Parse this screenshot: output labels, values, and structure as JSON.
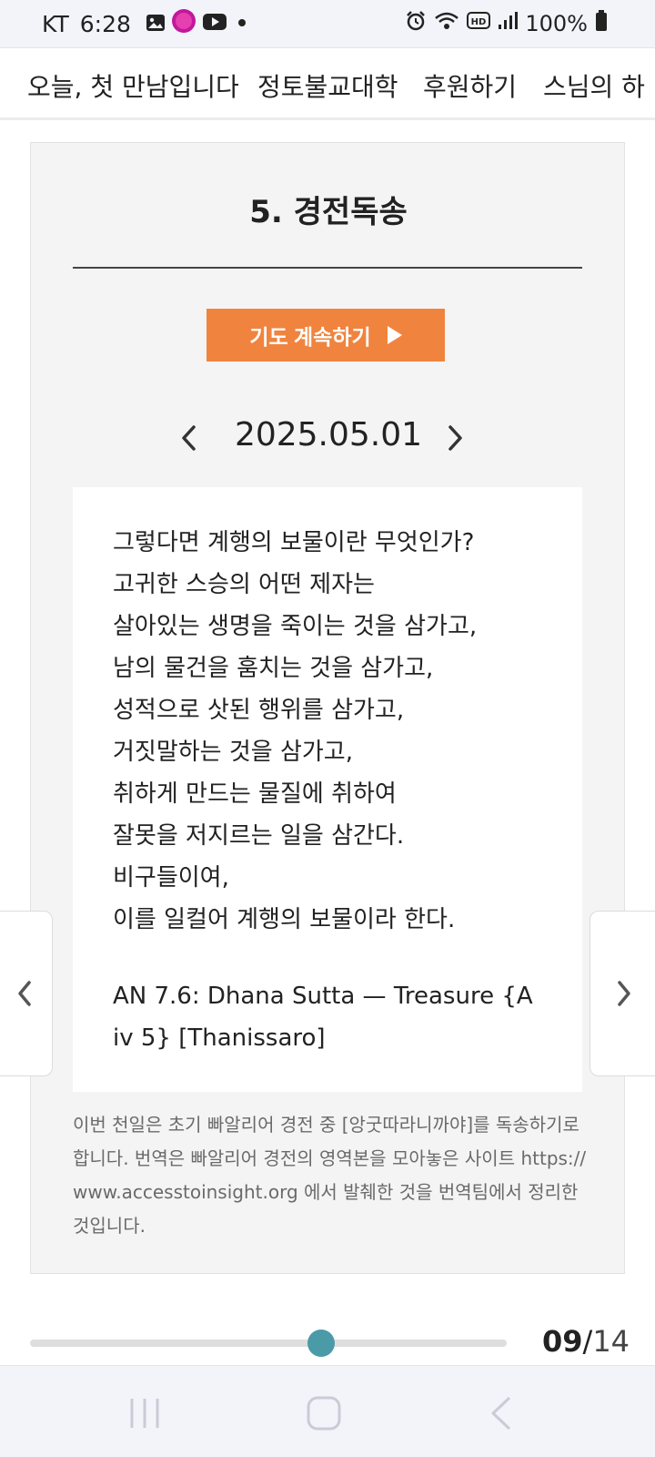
{
  "status_bar": {
    "carrier": "KT",
    "time": "6:28",
    "battery": "100%",
    "icons": [
      "gallery-icon",
      "busan-app-icon",
      "youtube-icon",
      "dot-icon",
      "alarm-icon",
      "wifi-icon",
      "hd-icon",
      "signal-icon",
      "battery-icon"
    ]
  },
  "top_nav": {
    "items": [
      "오늘, 첫 만남입니다",
      "정토불교대학",
      "후원하기",
      "스님의 하"
    ]
  },
  "section": {
    "title": "5. 경전독송",
    "continue_label": "기도 계속하기"
  },
  "date": "2025.05.01",
  "verse": {
    "lines": [
      "그렇다면 계행의 보물이란 무엇인가?",
      "고귀한 스승의 어떤 제자는",
      "살아있는 생명을 죽이는 것을 삼가고,",
      "남의 물건을 훔치는 것을 삼가고,",
      "성적으로 삿된 행위를 삼가고,",
      "거짓말하는 것을 삼가고,",
      "취하게 만드는 물질에 취하여",
      "잘못을 저지르는 일을 삼간다.",
      "비구들이여,",
      "이를 일컬어 계행의 보물이라 한다."
    ],
    "source": "AN 7.6: Dhana Sutta — Treasure {A iv 5} [Thanissaro]"
  },
  "footnote": "이번 천일은 초기 빠알리어 경전 중 [앙굿따라니까야]를 독송하기로 합니다. 번역은 빠알리어 경전의 영역본을 모아놓은 사이트 https://www.accesstoinsight.org 에서 발췌한 것을 번역팀에서 정리한 것입니다.",
  "progress": {
    "current": "09",
    "separator": "/",
    "total": "14",
    "fraction": 0.61
  },
  "colors": {
    "accent_button": "#f0843f",
    "progress_thumb": "#4b9aa8",
    "card_background": "#f4f4f4"
  }
}
